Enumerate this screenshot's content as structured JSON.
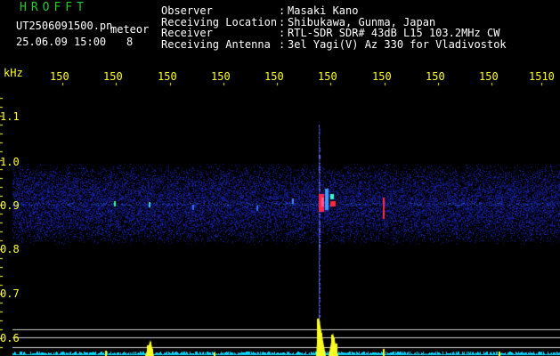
{
  "header": {
    "app_title": "HROFFT",
    "filename": "UT2506091500.pn",
    "event_type": "meteor",
    "datetime": "25.06.09 15:00",
    "count": "8"
  },
  "info": {
    "rows": [
      {
        "label": "Observer",
        "value": "Masaki Kano"
      },
      {
        "label": "Receiving Location",
        "value": "Shibukawa, Gunma, Japan"
      },
      {
        "label": "Receiver",
        "value": "RTL-SDR SDR# 43dB L15 103.2MHz CW"
      },
      {
        "label": "Receiving Antenna",
        "value": "3el Yagi(V) Az 330 for Vladivostok"
      }
    ],
    "separator": ":"
  },
  "axis": {
    "y_unit": "kHz",
    "y_ticks": [
      "1.1",
      "1.0",
      "0.9",
      "0.8",
      "0.7",
      "0.6"
    ],
    "x_ticks": [
      "150",
      "150",
      "150",
      "150",
      "150",
      "150",
      "150",
      "150",
      "150",
      "1510"
    ]
  },
  "colors": {
    "background": "#000000",
    "title_green": "#23c831",
    "label_yellow": "#ffff23",
    "info_white": "#ffffff",
    "baseline_cyan": "#00e0ff",
    "signal_red": "#ff2a3a",
    "band_blue": "#1a2aa8"
  }
}
